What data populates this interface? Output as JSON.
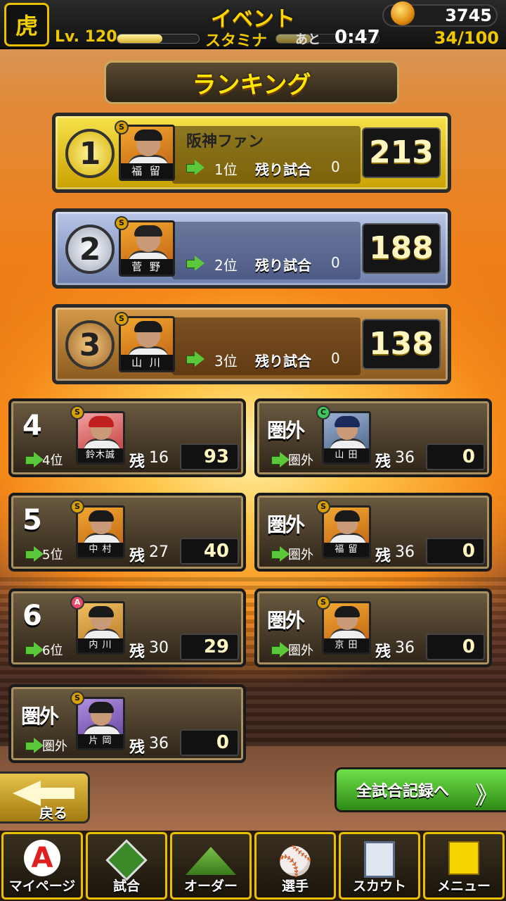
{
  "header": {
    "title": "イベント",
    "logo": "虎",
    "coins": "3745",
    "level": "Lv. 120",
    "stamina_label": "スタミナ",
    "ato": "あと",
    "timer": "0:47",
    "stamina": "34/100",
    "level_progress": 0.55,
    "stamina_progress": 0.34
  },
  "ranking_title": "ランキング",
  "top3": [
    {
      "medal": "1",
      "rarity": "S",
      "player": "福 留",
      "name": "阪神ファン",
      "rank": "1位",
      "remaining_label": "残り試合",
      "remaining": "0",
      "score": "213"
    },
    {
      "medal": "2",
      "rarity": "S",
      "player": "菅 野",
      "name": "",
      "rank": "2位",
      "remaining_label": "残り試合",
      "remaining": "0",
      "score": "188"
    },
    {
      "medal": "3",
      "rarity": "S",
      "player": "山 川",
      "name": "",
      "rank": "3位",
      "remaining_label": "残り試合",
      "remaining": "0",
      "score": "138"
    }
  ],
  "others": [
    {
      "rank_big": "4",
      "rarity": "S",
      "player": "鈴木誠",
      "rank": "4位",
      "zan": "残",
      "remaining": "16",
      "score": "93"
    },
    {
      "rank_big": "圏外",
      "rarity": "C",
      "player": "山 田",
      "rank": "圏外",
      "zan": "残",
      "remaining": "36",
      "score": "0"
    },
    {
      "rank_big": "5",
      "rarity": "S",
      "player": "中 村",
      "rank": "5位",
      "zan": "残",
      "remaining": "27",
      "score": "40"
    },
    {
      "rank_big": "圏外",
      "rarity": "S",
      "player": "福 留",
      "rank": "圏外",
      "zan": "残",
      "remaining": "36",
      "score": "0"
    },
    {
      "rank_big": "6",
      "rarity": "A",
      "player": "内 川",
      "rank": "6位",
      "zan": "残",
      "remaining": "30",
      "score": "29"
    },
    {
      "rank_big": "圏外",
      "rarity": "S",
      "player": "京 田",
      "rank": "圏外",
      "zan": "残",
      "remaining": "36",
      "score": "0"
    },
    {
      "rank_big": "圏外",
      "rarity": "S",
      "player": "片 岡",
      "rank": "圏外",
      "zan": "残",
      "remaining": "36",
      "score": "0"
    }
  ],
  "buttons": {
    "back": "戻る",
    "all_records": "全試合記録へ",
    "all_records_chevron": "》"
  },
  "nav": [
    {
      "label": "マイページ",
      "icon": "A"
    },
    {
      "label": "試合",
      "icon": ""
    },
    {
      "label": "オーダー",
      "icon": ""
    },
    {
      "label": "選手",
      "icon": "⚾"
    },
    {
      "label": "スカウト",
      "icon": ""
    },
    {
      "label": "メニュー",
      "icon": ""
    }
  ]
}
